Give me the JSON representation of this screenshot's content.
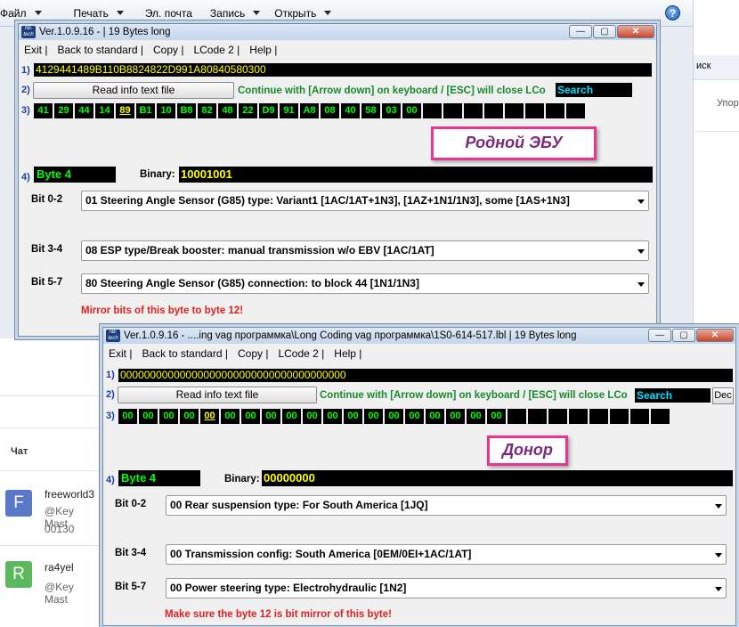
{
  "bg_menu": [
    "Файл",
    "Печать",
    "Эл. почта",
    "Запись",
    "Открыть"
  ],
  "right_pane": {
    "r1": "иск",
    "r2": "Упор"
  },
  "chat": {
    "header": "Чат",
    "items": [
      {
        "avatar": "F",
        "color": "#5b77c8",
        "name": "freeworld3",
        "line1": "@Key Mast",
        "line2": "00130"
      },
      {
        "avatar": "R",
        "color": "#5cb85c",
        "name": "ra4yel",
        "line1": "@Key Mast",
        "line2": ""
      }
    ]
  },
  "win1": {
    "logo": "NE tech",
    "title": "Ver.1.0.9.16 -    | 19 Bytes long",
    "menu": [
      "Exit |",
      "Back to standard |",
      "Copy |",
      "LCode 2 |",
      "Help |"
    ],
    "row1": "1)",
    "row2": "2)",
    "row3": "3)",
    "row4": "4)",
    "hex": "4129441489B110B8824822D991A80840580300",
    "read_btn": "Read info text file",
    "continue": "Continue with [Arrow down] on keyboard / [ESC] will close LCo",
    "search": "Search",
    "bytes": [
      "41",
      "29",
      "44",
      "14",
      "89",
      "B1",
      "10",
      "B8",
      "82",
      "48",
      "22",
      "D9",
      "91",
      "A8",
      "08",
      "40",
      "58",
      "03",
      "00",
      "",
      "",
      "",
      "",
      "",
      "",
      "",
      ""
    ],
    "selected_index": 4,
    "byte_label": "Byte 4",
    "binary_label": "Binary:",
    "binary": "10001001",
    "bits": [
      {
        "label": "Bit 0-2",
        "value": "01 Steering Angle Sensor (G85) type: Variant1 [1AC/1AT+1N3], [1AZ+1N1/1N3], some [1AS+1N3]"
      },
      {
        "label": "Bit 3-4",
        "value": "08 ESP type/Break booster: manual transmission w/o EBV [1AC/1AT]"
      },
      {
        "label": "Bit 5-7",
        "value": "80 Steering Angle Sensor (G85) connection: to block 44 [1N1/1N3]"
      }
    ],
    "note": "Mirror bits of this byte to byte 12!"
  },
  "annot1": "Родной ЭБУ",
  "win2": {
    "logo": "NE tech",
    "title": "Ver.1.0.9.16 - ....ing vag программка\\Long Coding vag программка\\1S0-614-517.lbl | 19 Bytes long",
    "menu": [
      "Exit |",
      "Back to standard |",
      "Copy |",
      "LCode 2 |",
      "Help |"
    ],
    "row1": "1)",
    "row2": "2)",
    "row3": "3)",
    "row4": "4)",
    "hex": "00000000000000000000000000000000000000",
    "read_btn": "Read info text file",
    "continue": "Continue with [Arrow down] on keyboard / [ESC] will close LCo",
    "search": "Search",
    "dec": "Dec",
    "bytes": [
      "00",
      "00",
      "00",
      "00",
      "00",
      "00",
      "00",
      "00",
      "00",
      "00",
      "00",
      "00",
      "00",
      "00",
      "00",
      "00",
      "00",
      "00",
      "00",
      "",
      "",
      "",
      "",
      "",
      "",
      "",
      ""
    ],
    "selected_index": 4,
    "byte_label": "Byte 4",
    "binary_label": "Binary:",
    "binary": "00000000",
    "bits": [
      {
        "label": "Bit 0-2",
        "value": "00 Rear suspension type: For South America [1JQ]"
      },
      {
        "label": "Bit 3-4",
        "value": "00 Transmission config: South America [0EM/0EI+1AC/1AT]"
      },
      {
        "label": "Bit 5-7",
        "value": "00 Power steering type: Electrohydraulic [1N2]"
      }
    ],
    "note": "Make sure the byte 12 is bit mirror of this byte!"
  },
  "annot2": "Донор"
}
